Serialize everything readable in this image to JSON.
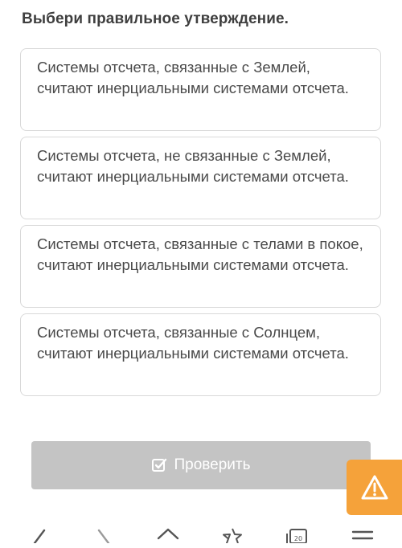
{
  "question": {
    "title": "Выбери правильное утверждение."
  },
  "options": [
    {
      "text": "Системы отсчета, связанные с Землей, считают инерциальными системами отсчета."
    },
    {
      "text": "Системы отсчета, не связанные с Землей, считают инерциальными системами отсчета."
    },
    {
      "text": "Системы отсчета, связанные с телами в покое, считают инерциальными системами отсчета."
    },
    {
      "text": "Системы отсчета, связанные с Солнцем, считают инерциальными системами отсчета."
    }
  ],
  "actions": {
    "check_label": "Проверить",
    "check_icon": "checkbox-icon",
    "warning_icon": "warning-triangle-icon"
  },
  "bottom_nav": {
    "items": [
      "back-arrow-icon",
      "forward-arrow-icon",
      "home-icon",
      "star-icon",
      "tabs-icon",
      "menu-icon"
    ],
    "tabs_count": "20"
  },
  "colors": {
    "button_disabled": "#c4c4c4",
    "warning": "#f5a23a",
    "option_border": "#d9d9d9"
  }
}
